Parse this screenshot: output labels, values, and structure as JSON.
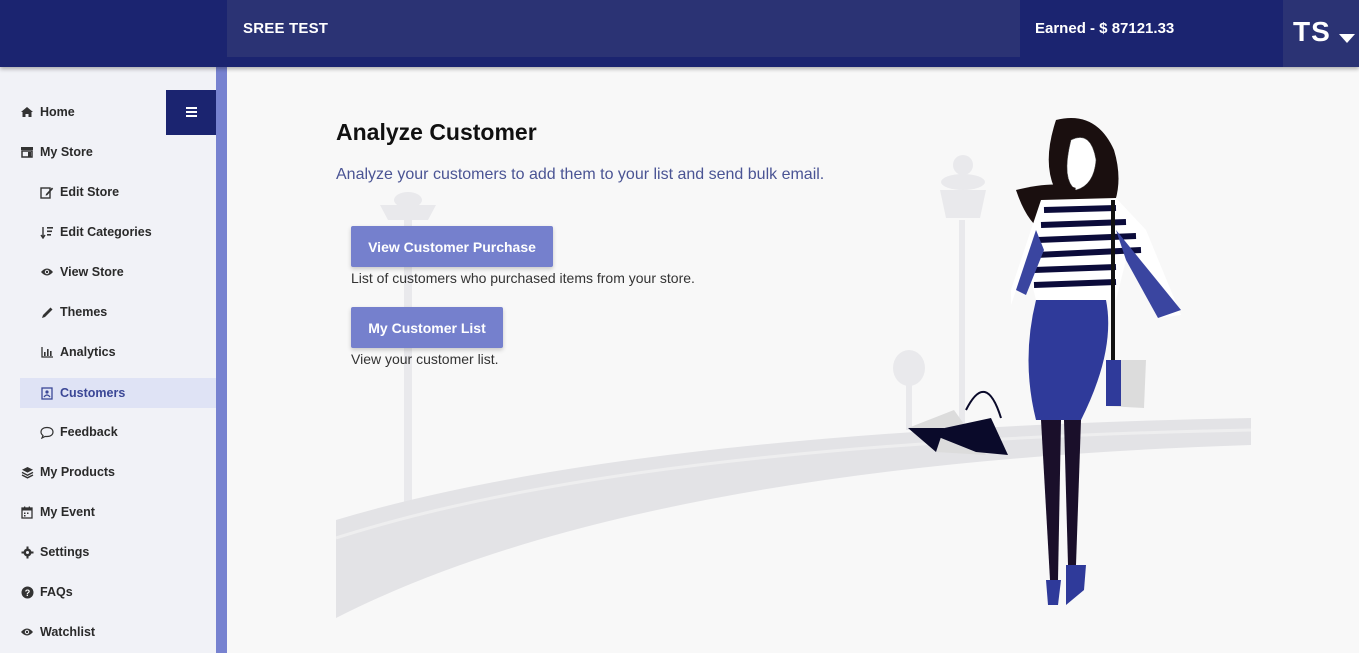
{
  "header": {
    "store_name": "SREE TEST",
    "earned": "Earned - $ 87121.33",
    "avatar_initials": "TS"
  },
  "sidebar": {
    "items": [
      {
        "label": "Home",
        "icon": "home-icon"
      },
      {
        "label": "My Store",
        "icon": "store-icon"
      },
      {
        "label": "Edit Store",
        "icon": "edit-icon"
      },
      {
        "label": "Edit Categories",
        "icon": "sort-icon"
      },
      {
        "label": "View Store",
        "icon": "eye-icon"
      },
      {
        "label": "Themes",
        "icon": "pencil-icon"
      },
      {
        "label": "Analytics",
        "icon": "bar-chart-icon"
      },
      {
        "label": "Customers",
        "icon": "contact-card-icon",
        "active": true
      },
      {
        "label": "Feedback",
        "icon": "comment-icon"
      },
      {
        "label": "My Products",
        "icon": "layers-icon"
      },
      {
        "label": "My Event",
        "icon": "calendar-icon"
      },
      {
        "label": "Settings",
        "icon": "gear-icon"
      },
      {
        "label": "FAQs",
        "icon": "question-circle-icon"
      },
      {
        "label": "Watchlist",
        "icon": "eye-icon"
      }
    ]
  },
  "main": {
    "title": "Analyze Customer",
    "subtitle": "Analyze your customers to add them to your list and send bulk email.",
    "actions": [
      {
        "label": "View Customer Purchase",
        "description": "List of customers who purchased items from your store."
      },
      {
        "label": "My Customer List",
        "description": "View your customer list."
      }
    ]
  },
  "colors": {
    "topbar": "#1b2470",
    "accent": "#7580cd",
    "active_bg": "#dfe3f5"
  }
}
